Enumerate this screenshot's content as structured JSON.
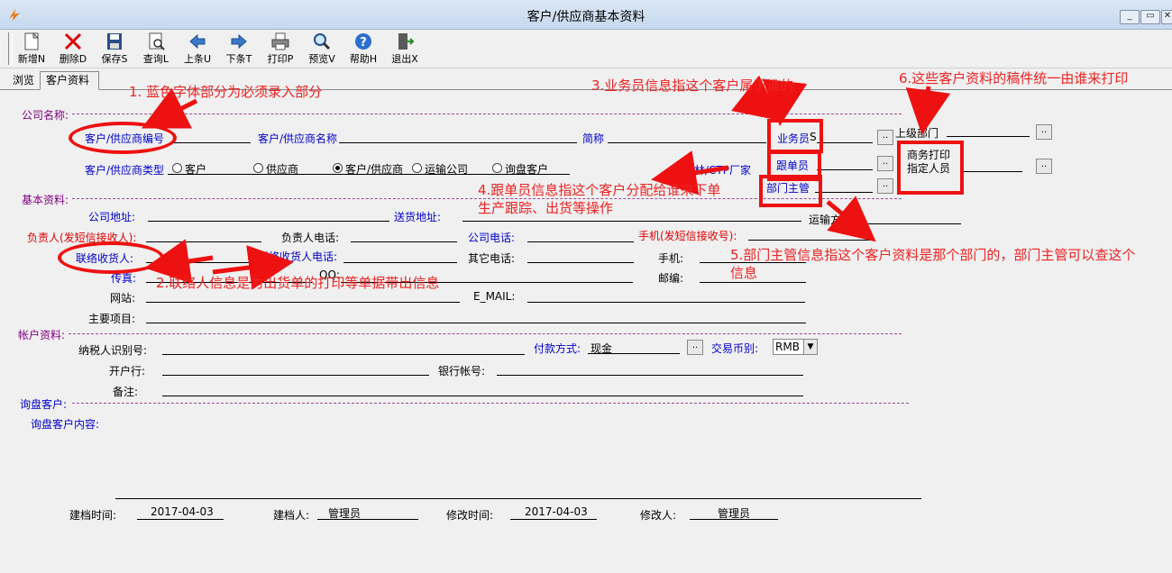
{
  "window": {
    "title": "客户/供应商基本资料"
  },
  "toolbar": [
    {
      "id": "new",
      "label": "新增N"
    },
    {
      "id": "delete",
      "label": "删除D"
    },
    {
      "id": "save",
      "label": "保存S"
    },
    {
      "id": "query",
      "label": "查询L"
    },
    {
      "id": "prev",
      "label": "上条U"
    },
    {
      "id": "next",
      "label": "下条T"
    },
    {
      "id": "print",
      "label": "打印P"
    },
    {
      "id": "preview",
      "label": "预览V"
    },
    {
      "id": "help",
      "label": "帮助H"
    },
    {
      "id": "exit",
      "label": "退出X"
    }
  ],
  "tabs": {
    "browse": "浏览",
    "customer": "客户资料"
  },
  "sections": {
    "company": "公司名称:",
    "basic": "基本资料:",
    "account": "帐户资料:",
    "inquiry": "询盘客户:",
    "inquiry_content": "询盘客户内容:"
  },
  "fields": {
    "code": "客户/供应商编号",
    "name": "客户/供应商名称",
    "short": "简称",
    "salesman": "业务员",
    "salesman_val": "S",
    "follower": "跟单员",
    "dept_head": "部门主管",
    "parent_dept": "上级部门",
    "print_assignee": "商务打印指定人员",
    "type": "客户/供应商类型",
    "type_options": [
      "客户",
      "供应商",
      "客户/供应商",
      "运输公司",
      "询盘客户"
    ],
    "fedex": "菲林/CTP厂家",
    "address": "公司地址:",
    "delivery": "送货地址:",
    "transport": "运输方式:",
    "owner": "负责人(发短信接收人):",
    "owner_phone": "负责人电话:",
    "company_phone": "公司电话:",
    "mobile_sms": "手机(发短信接收号):",
    "contact": "联络收货人:",
    "contact_phone": "联络收货人电话:",
    "other_phone": "其它电话:",
    "mobile": "手机:",
    "fax": "传真:",
    "qq": "QQ:",
    "zip": "邮编:",
    "website": "网站:",
    "email": "E_MAIL:",
    "main_items": "主要项目:",
    "tax_id": "纳税人识别号:",
    "payment": "付款方式:",
    "payment_val": "现金",
    "currency": "交易币别:",
    "currency_val": "RMB",
    "bank": "开户行:",
    "bank_account": "银行帐号:",
    "remark": "备注:"
  },
  "footer": {
    "created_time_label": "建档时间:",
    "created_time": "2017-04-03",
    "creator_label": "建档人:",
    "creator": "管理员",
    "modified_time_label": "修改时间:",
    "modified_time": "2017-04-03",
    "modifier_label": "修改人:",
    "modifier": "管理员"
  },
  "annotations": {
    "a1": "1. 蓝色字体部分为必须录入部分",
    "a2": "2.联络人信息是为出货单的打印等单据带出信息",
    "a3": "3.业务员信息指这个客户属于谁的",
    "a4_line1": "4.跟单员信息指这个客户分配给谁来下单",
    "a4_line2": "生产跟踪、出货等操作",
    "a5_line1": "5.部门主管信息指这个客户资料是那个部门的，部门主管可以查这个",
    "a5_line2": "信息",
    "a6": "6.这些客户资料的稿件统一由谁来打印"
  }
}
